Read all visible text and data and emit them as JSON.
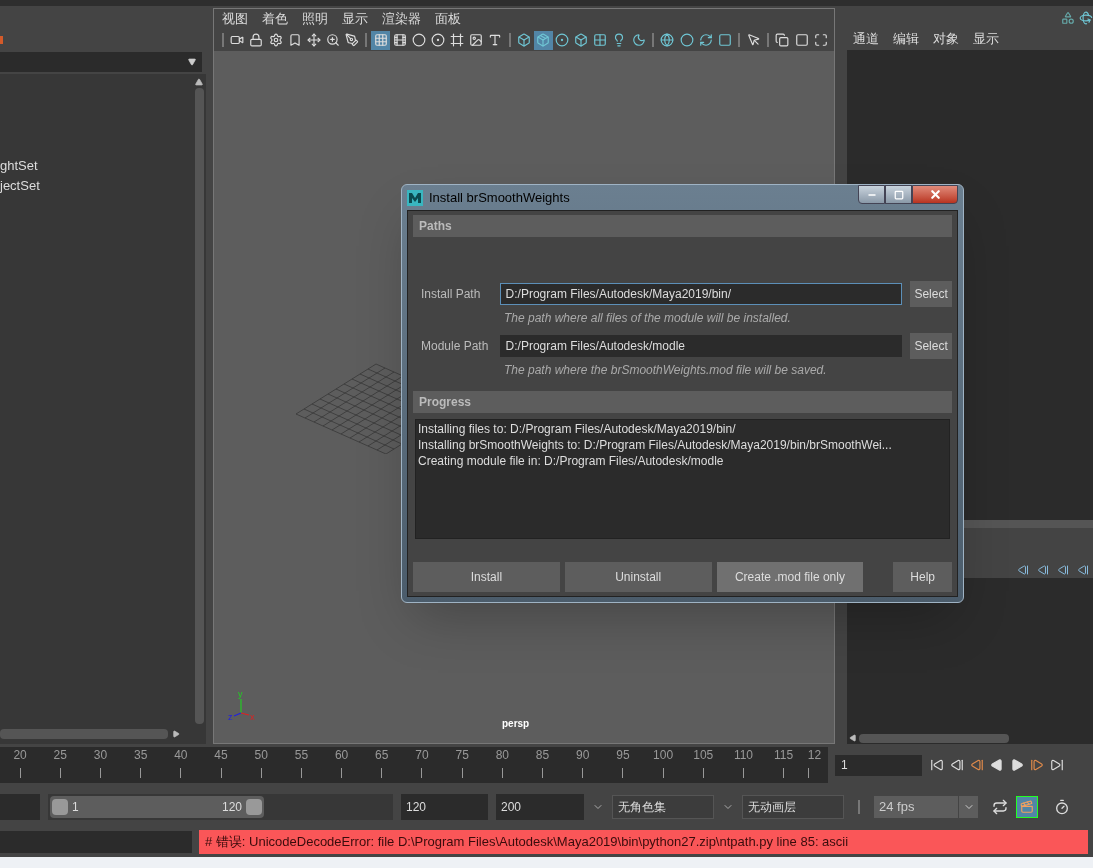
{
  "left_panel": {
    "list_items": [
      "ghtSet",
      "jectSet"
    ]
  },
  "viewport": {
    "menu": [
      "视图",
      "着色",
      "照明",
      "显示",
      "渲染器",
      "面板"
    ],
    "toolbar_groups": [
      [
        {
          "selected": false
        },
        {
          "selected": false
        },
        {
          "selected": false
        },
        {
          "selected": false
        },
        {
          "selected": false
        },
        {
          "selected": false
        },
        {
          "selected": false
        }
      ],
      [
        {
          "selected": true
        },
        {
          "selected": false
        },
        {
          "selected": false
        },
        {
          "selected": false
        },
        {
          "selected": false
        },
        {
          "selected": false
        },
        {
          "selected": false
        }
      ],
      [
        {
          "selected": false
        },
        {
          "selected": true
        },
        {
          "selected": false
        },
        {
          "selected": false
        },
        {
          "selected": false
        },
        {
          "selected": false
        },
        {
          "selected": false
        }
      ],
      [
        {
          "selected": false
        },
        {
          "selected": false
        },
        {
          "selected": false
        },
        {
          "selected": false
        }
      ],
      [
        {
          "selected": false
        }
      ],
      [
        {
          "selected": false
        },
        {
          "selected": false
        },
        {
          "selected": false
        }
      ]
    ],
    "axis_labels": [
      "y",
      "z",
      "x"
    ],
    "camera_label": "persp"
  },
  "channel_box": {
    "menu": [
      "通道",
      "编辑",
      "对象",
      "显示"
    ]
  },
  "dialog": {
    "title": "Install brSmoothWeights",
    "paths_header": "Paths",
    "fields": [
      {
        "label": "Install Path",
        "value": "D:/Program Files/Autodesk/Maya2019/bin/",
        "focused": true,
        "button": "Select",
        "hint": "The path where all files of the module will be installed."
      },
      {
        "label": "Module Path",
        "value": "D:/Program Files/Autodesk/modle",
        "focused": false,
        "button": "Select",
        "hint": "The path where the brSmoothWeights.mod file will be saved."
      }
    ],
    "progress_header": "Progress",
    "log": [
      "Installing files to: D:/Program Files/Autodesk/Maya2019/bin/",
      "Installing brSmoothWeights to: D:/Program Files/Autodesk/Maya2019/bin/brSmoothWei...",
      "Creating module file in: D:/Program Files/Autodesk/modle"
    ],
    "buttons": [
      {
        "label": "Install",
        "hovered": false
      },
      {
        "label": "Uninstall",
        "hovered": false
      },
      {
        "label": "Create .mod file only",
        "hovered": true
      },
      {
        "label": "Help",
        "hovered": false
      }
    ]
  },
  "timeline": {
    "ticks": [
      "20",
      "25",
      "30",
      "35",
      "40",
      "45",
      "50",
      "55",
      "60",
      "65",
      "70",
      "75",
      "80",
      "85",
      "90",
      "95",
      "100",
      "105",
      "110",
      "115",
      "12"
    ],
    "current_frame": "1"
  },
  "range": {
    "start": "1",
    "end": "120",
    "anim_end": "120",
    "max": "200",
    "character_set": "无角色集",
    "anim_layer": "无动画层",
    "fps": "24 fps"
  },
  "command_line": {
    "error": "# 错误: UnicodeDecodeError: file D:\\Program Files\\Autodesk\\Maya2019\\bin\\python27.zip\\ntpath.py line 85: ascii"
  }
}
